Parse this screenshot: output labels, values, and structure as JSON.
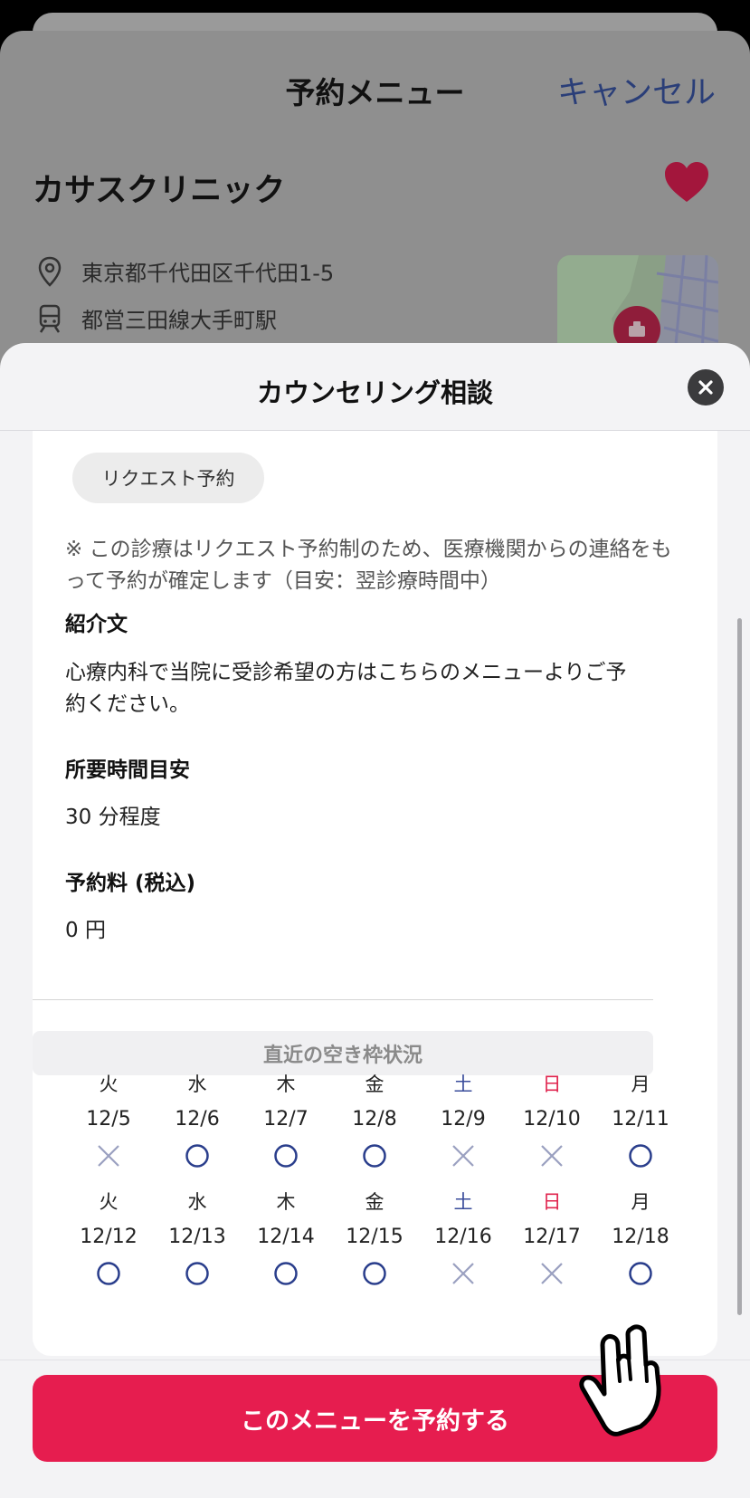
{
  "under_page": {
    "title": "予約メニュー",
    "cancel_label": "キャンセル",
    "clinic_name": "カサスクリニック",
    "address": "東京都千代田区千代田1-5",
    "station": "都営三田線大手町駅"
  },
  "sheet": {
    "title": "カウンセリング相談",
    "request_chip": "リクエスト予約",
    "note": "※ この診療はリクエスト予約制のため、医療機関からの連絡をもって予約が確定します（目安：翌診療時間中）",
    "intro_heading": "紹介文",
    "intro_text": "心療内科で当院に受診希望の方はこちらのメニューよりご予約ください。",
    "duration_heading": "所要時間目安",
    "duration_text": "30 分程度",
    "fee_heading": "予約料 (税込)",
    "fee_text": "0 円",
    "availability_heading": "直近の空き枠状況",
    "week1": [
      {
        "dow": "火",
        "date": "12/5",
        "status": "unavailable",
        "kind": "weekday"
      },
      {
        "dow": "水",
        "date": "12/6",
        "status": "available",
        "kind": "weekday"
      },
      {
        "dow": "木",
        "date": "12/7",
        "status": "available",
        "kind": "weekday"
      },
      {
        "dow": "金",
        "date": "12/8",
        "status": "available",
        "kind": "weekday"
      },
      {
        "dow": "土",
        "date": "12/9",
        "status": "unavailable",
        "kind": "sat"
      },
      {
        "dow": "日",
        "date": "12/10",
        "status": "unavailable",
        "kind": "sun"
      },
      {
        "dow": "月",
        "date": "12/11",
        "status": "available",
        "kind": "weekday"
      }
    ],
    "week2": [
      {
        "dow": "火",
        "date": "12/12",
        "status": "available",
        "kind": "weekday"
      },
      {
        "dow": "水",
        "date": "12/13",
        "status": "available",
        "kind": "weekday"
      },
      {
        "dow": "木",
        "date": "12/14",
        "status": "available",
        "kind": "weekday"
      },
      {
        "dow": "金",
        "date": "12/15",
        "status": "available",
        "kind": "weekday"
      },
      {
        "dow": "土",
        "date": "12/16",
        "status": "unavailable",
        "kind": "sat"
      },
      {
        "dow": "日",
        "date": "12/17",
        "status": "unavailable",
        "kind": "sun"
      },
      {
        "dow": "月",
        "date": "12/18",
        "status": "available",
        "kind": "weekday"
      }
    ],
    "reserve_button": "このメニューを予約する"
  },
  "colors": {
    "accent": "#e61d4f",
    "available_mark": "#2a3e8c",
    "unavailable_mark": "#9aa0c0",
    "saturday": "#3a4c9b",
    "sunday": "#e0244e",
    "heart": "#a3163c"
  },
  "icons": {
    "location": "location-pin-icon",
    "train": "train-icon",
    "favorite": "heart-icon",
    "close": "close-icon",
    "pointer": "hand-pointer-icon"
  }
}
